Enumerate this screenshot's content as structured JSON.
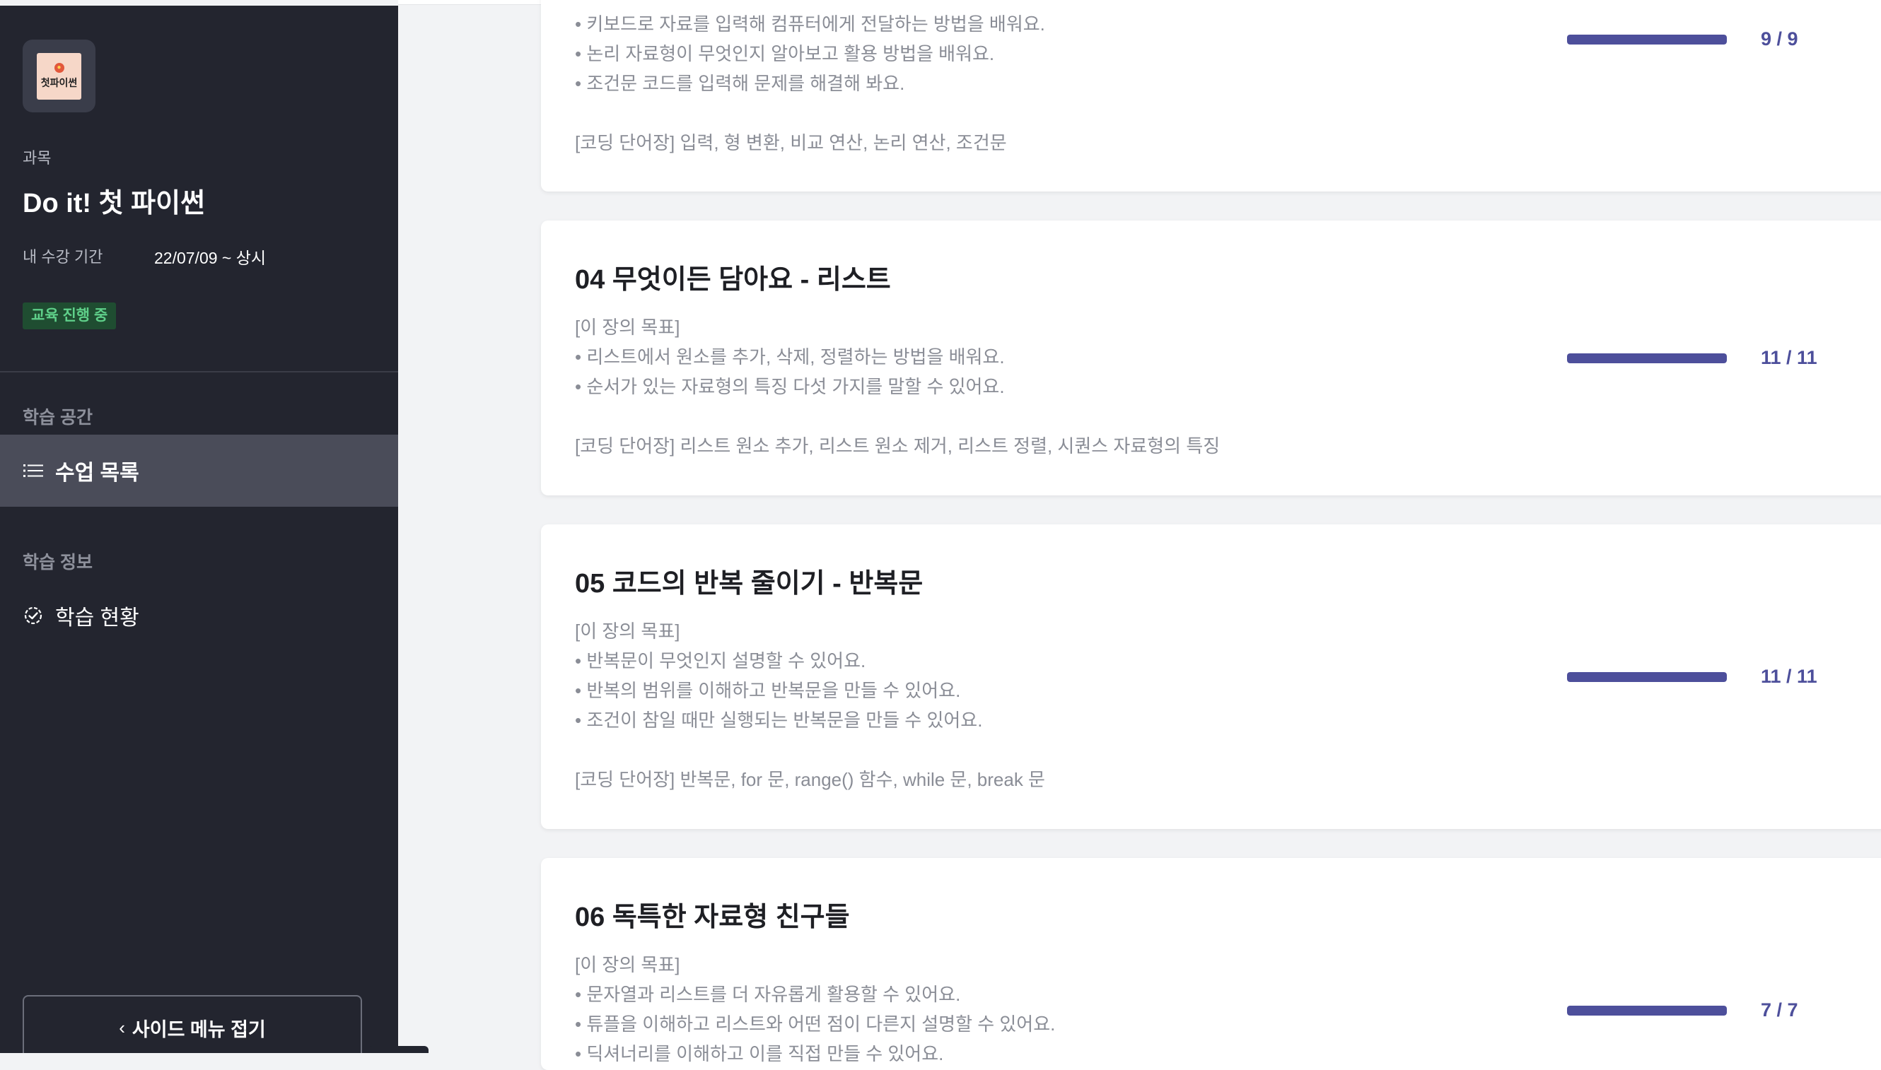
{
  "sidebar": {
    "logo_text": "첫파이썬",
    "course_label": "과목",
    "course_title": "Do it! 첫 파이썬",
    "period_label": "내 수강 기간",
    "period_value": "22/07/09 ~ 상시",
    "status_badge": "교육 진행 중",
    "sections": [
      {
        "title": "학습 공간",
        "items": [
          {
            "label": "수업 목록",
            "icon": "list-icon",
            "active": true
          }
        ]
      },
      {
        "title": "학습 정보",
        "items": [
          {
            "label": "학습 현황",
            "icon": "check-circle-icon",
            "active": false
          }
        ]
      }
    ],
    "collapse_label": "사이드 메뉴 접기"
  },
  "chapters": [
    {
      "title": "",
      "lines": [
        "• 키보드로 자료를 입력해 컴퓨터에게 전달하는 방법을 배워요.",
        "• 논리 자료형이 무엇인지 알아보고 활용 방법을 배워요.",
        "• 조건문 코드를 입력해 문제를 해결해 봐요."
      ],
      "keywords": "[코딩 단어장] 입력, 형 변환, 비교 연산, 논리 연산, 조건문",
      "progress_text": "9 / 9",
      "progress_fraction": 1.0
    },
    {
      "title": "04 무엇이든 담아요 - 리스트",
      "goal_label": "[이 장의 목표]",
      "lines": [
        "• 리스트에서 원소를 추가, 삭제, 정렬하는 방법을 배워요.",
        "• 순서가 있는 자료형의 특징 다섯 가지를 말할 수 있어요."
      ],
      "keywords": "[코딩 단어장] 리스트 원소 추가, 리스트 원소 제거, 리스트 정렬, 시퀀스 자료형의 특징",
      "progress_text": "11 / 11",
      "progress_fraction": 1.0
    },
    {
      "title": "05 코드의 반복 줄이기 - 반복문",
      "goal_label": "[이 장의 목표]",
      "lines": [
        "• 반복문이 무엇인지 설명할 수 있어요.",
        "• 반복의 범위를 이해하고 반복문을 만들 수 있어요.",
        "• 조건이 참일 때만 실행되는 반복문을 만들 수 있어요."
      ],
      "keywords": "[코딩 단어장] 반복문, for 문, range() 함수, while 문, break 문",
      "progress_text": "11 / 11",
      "progress_fraction": 1.0
    },
    {
      "title": "06 독특한 자료형 친구들",
      "goal_label": "[이 장의 목표]",
      "lines": [
        "• 문자열과 리스트를 더 자유롭게 활용할 수 있어요.",
        "• 튜플을 이해하고 리스트와 어떤 점이 다른지 설명할 수 있어요.",
        "• 딕셔너리를 이해하고 이를 직접 만들 수 있어요."
      ],
      "keywords": "",
      "progress_text": "7 / 7",
      "progress_fraction": 1.0
    }
  ]
}
